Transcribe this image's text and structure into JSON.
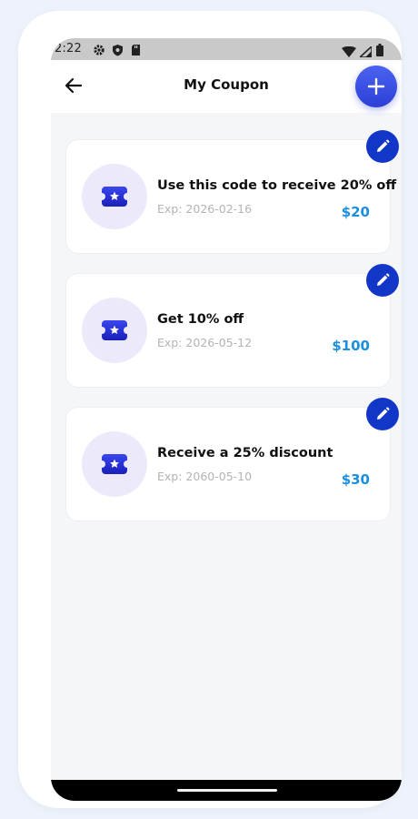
{
  "status_bar": {
    "time": "2:22",
    "icons": [
      "gear-icon",
      "shield-icon",
      "sd-card-icon",
      "wifi-icon",
      "signal-icon",
      "battery-icon"
    ]
  },
  "header": {
    "title": "My Coupon",
    "back_icon": "arrow-left-icon",
    "add_icon": "plus-icon"
  },
  "coupons": [
    {
      "title": "Use this code to receive 20% off",
      "expiry": "Exp: 2026-02-16",
      "amount": "$20"
    },
    {
      "title": "Get 10% off",
      "expiry": "Exp: 2026-05-12",
      "amount": "$100"
    },
    {
      "title": "Receive a 25% discount",
      "expiry": "Exp: 2060-05-10",
      "amount": "$30"
    }
  ],
  "colors": {
    "accent_blue": "#2c3fd8",
    "edit_button": "#1237c8",
    "amount_text": "#1a8fe0",
    "coupon_badge_bg": "#ece9fb",
    "background": "#f5f6f8"
  }
}
